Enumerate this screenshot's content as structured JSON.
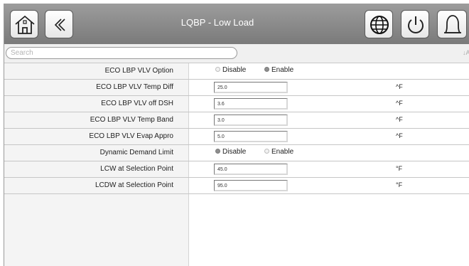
{
  "header": {
    "title": "LQBP - Low Load"
  },
  "search": {
    "placeholder": "Search",
    "sort_glyph": "↓A"
  },
  "rows": [
    {
      "label": "ECO LBP VLV Option",
      "type": "radio",
      "options": [
        "Disable",
        "Enable"
      ],
      "selected": "Enable"
    },
    {
      "label": "ECO LBP VLV Temp Diff",
      "type": "input",
      "value": "25.0",
      "unit": "^F"
    },
    {
      "label": "ECO LBP VLV off DSH",
      "type": "input",
      "value": "3.6",
      "unit": "^F"
    },
    {
      "label": "ECO LBP VLV Temp Band",
      "type": "input",
      "value": "3.0",
      "unit": "^F"
    },
    {
      "label": "ECO LBP VLV Evap Appro",
      "type": "input",
      "value": "5.0",
      "unit": "^F"
    },
    {
      "label": "Dynamic Demand Limit",
      "type": "radio",
      "options": [
        "Disable",
        "Enable"
      ],
      "selected": "Disable"
    },
    {
      "label": "LCW at Selection Point",
      "type": "input",
      "value": "45.0",
      "unit": "°F"
    },
    {
      "label": "LCDW at Selection Point",
      "type": "input",
      "value": "95.0",
      "unit": "°F"
    }
  ],
  "icons": [
    "home-icon",
    "back-icon",
    "globe-icon",
    "power-icon",
    "bell-icon"
  ]
}
